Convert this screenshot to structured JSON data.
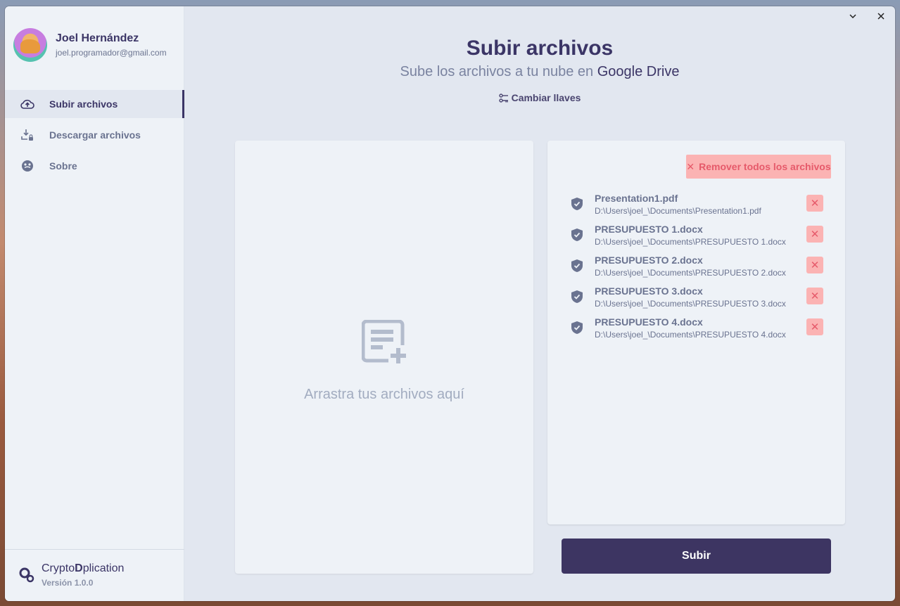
{
  "user": {
    "name": "Joel Hernández",
    "email": "joel.programador@gmail.com"
  },
  "nav": [
    {
      "label": "Subir archivos",
      "icon": "cloud-upload-icon",
      "active": true
    },
    {
      "label": "Descargar archivos",
      "icon": "download-lock-icon",
      "active": false
    },
    {
      "label": "Sobre",
      "icon": "info-circle-icon",
      "active": false
    }
  ],
  "app": {
    "name_prefix": "Crypto",
    "name_bold": "D",
    "name_suffix": "plication",
    "version": "Versión 1.0.0"
  },
  "header": {
    "title": "Subir archivos",
    "subtitle_prefix": "Sube los archivos a tu nube en ",
    "subtitle_service": "Google Drive",
    "keys_link": "Cambiar llaves"
  },
  "dropzone": {
    "text": "Arrastra tus archivos aquí"
  },
  "files": {
    "remove_all_label": "Remover todos los archivos",
    "items": [
      {
        "name": "Presentation1.pdf",
        "path": "D:\\Users\\joel_\\Documents\\Presentation1.pdf"
      },
      {
        "name": "PRESUPUESTO 1.docx",
        "path": "D:\\Users\\joel_\\Documents\\PRESUPUESTO 1.docx"
      },
      {
        "name": "PRESUPUESTO 2.docx",
        "path": "D:\\Users\\joel_\\Documents\\PRESUPUESTO 2.docx"
      },
      {
        "name": "PRESUPUESTO 3.docx",
        "path": "D:\\Users\\joel_\\Documents\\PRESUPUESTO 3.docx"
      },
      {
        "name": "PRESUPUESTO 4.docx",
        "path": "D:\\Users\\joel_\\Documents\\PRESUPUESTO 4.docx"
      }
    ]
  },
  "upload_button": "Subir",
  "colors": {
    "primary": "#3d3562",
    "danger_bg": "#fbb3b3",
    "danger_fg": "#e65a6a",
    "background": "#e2e7f0"
  }
}
